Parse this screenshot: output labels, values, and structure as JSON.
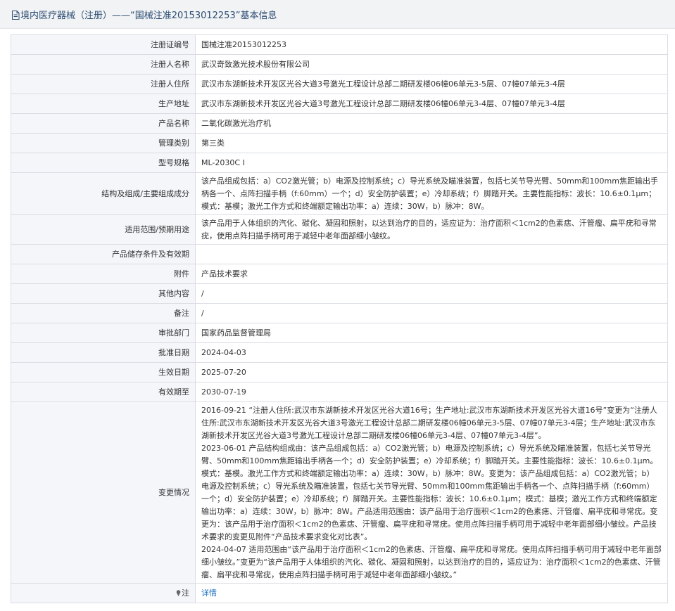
{
  "header": {
    "title": "境内医疗器械（注册）——“国械注准20153012253”基本信息"
  },
  "rows": [
    {
      "label": "注册证编号",
      "value": "国械注准20153012253"
    },
    {
      "label": "注册人名称",
      "value": "武汉奇致激光技术股份有限公司"
    },
    {
      "label": "注册人住所",
      "value": "武汉市东湖新技术开发区光谷大道3号激光工程设计总部二期研发楼06幢06单元3-5层、07幢07单元3-4层"
    },
    {
      "label": "生产地址",
      "value": "武汉市东湖新技术开发区光谷大道3号激光工程设计总部二期研发楼06幢06单元3-4层、07幢07单元3-4层"
    },
    {
      "label": "产品名称",
      "value": "二氧化碳激光治疗机"
    },
    {
      "label": "管理类别",
      "value": "第三类"
    },
    {
      "label": "型号规格",
      "value": "ML-2030C I"
    },
    {
      "label": "结构及组成/主要组成成分",
      "value": "该产品组成包括：a）CO2激光管；b）电源及控制系统；c）导光系统及瞄准装置，包括七关节导光臂、50mm和100mm焦距输出手柄各一个、点阵扫描手柄（f:60mm）一个；d）安全防护装置；e）冷却系统；f）脚踏开关。主要性能指标：波长：10.6±0.1μm；模式：基模；激光工作方式和终端额定输出功率：a）连续：30W，b）脉冲：8W。"
    },
    {
      "label": "适用范围/预期用途",
      "value": "该产品用于人体组织的汽化、碳化、凝固和照射，以达到治疗的目的，适应证为：治疗面积＜1cm2的色素痣、汗管瘤、扁平疣和寻常疣，使用点阵扫描手柄可用于减轻中老年面部细小皱纹。"
    },
    {
      "label": "产品储存条件及有效期",
      "value": ""
    },
    {
      "label": "附件",
      "value": "产品技术要求"
    },
    {
      "label": "其他内容",
      "value": "/"
    },
    {
      "label": "备注",
      "value": "/"
    },
    {
      "label": "审批部门",
      "value": "国家药品监督管理局"
    },
    {
      "label": "批准日期",
      "value": "2024-04-03"
    },
    {
      "label": "生效日期",
      "value": "2025-07-20"
    },
    {
      "label": "有效期至",
      "value": "2030-07-19"
    }
  ],
  "changes": {
    "label": "变更情况",
    "entries": [
      "2016-09-21 “注册人住所:武汉市东湖新技术开发区光谷大道16号；生产地址:武汉市东湖新技术开发区光谷大道16号”变更为“注册人住所:武汉市东湖新技术开发区光谷大道3号激光工程设计总部二期研发楼06幢06单元3-5层、07幢07单元3-4层；生产地址:武汉市东湖新技术开发区光谷大道3号激光工程设计总部二期研发楼06幢06单元3-4层、07幢07单元3-4层”。",
      "2023-06-01 产品结构组成由：该产品组成包括：a）CO2激光管；b）电源及控制系统；c）导光系统及瞄准装置，包括七关节导光臂、50mm和100mm焦距输出手柄各一个；d）安全防护装置；e）冷却系统；f）脚踏开关。主要性能指标：波长：10.6±0.1μm。模式：基模。激光工作方式和终端额定输出功率：a）连续：30W，b）脉冲：8W。变更为：该产品组成包括：a）CO2激光管；b）电源及控制系统；c）导光系统及瞄准装置，包括七关节导光臂、50mm和100mm焦距输出手柄各一个、点阵扫描手柄（f:60mm）一个；d）安全防护装置；e）冷却系统；f）脚踏开关。主要性能指标：波长：10.6±0.1μm；模式：基模；激光工作方式和终端额定输出功率：a）连续：30W，b）脉冲：8W。产品适用范围由：该产品用于治疗面积＜1cm2的色素痣、汗管瘤、扁平疣和寻常疣。变更为：该产品用于治疗面积＜1cm2的色素痣、汗管瘤、扁平疣和寻常疣。使用点阵扫描手柄可用于减轻中老年面部细小皱纹。产品技术要求的变更见附件“产品技术要求变化对比表”。",
      "2024-04-07 适用范围由“该产品用于治疗面积＜1cm2的色素痣、汗管瘤、扁平疣和寻常疣。使用点阵扫描手柄可用于减轻中老年面部细小皱纹。”变更为“该产品用于人体组织的汽化、碳化、凝固和照射，以达到治疗的目的，适应证为：治疗面积＜1cm2的色素痣、汗管瘤、扁平疣和寻常疣，使用点阵扫描手柄可用于减轻中老年面部细小皱纹。”"
    ]
  },
  "note": {
    "label": "注",
    "icon": "pin-icon",
    "link_text": "详情"
  },
  "colors": {
    "title": "#2c4d73",
    "label_bg": "#f4f6f9",
    "border": "#d9dde3",
    "link": "#1a6fc0"
  }
}
